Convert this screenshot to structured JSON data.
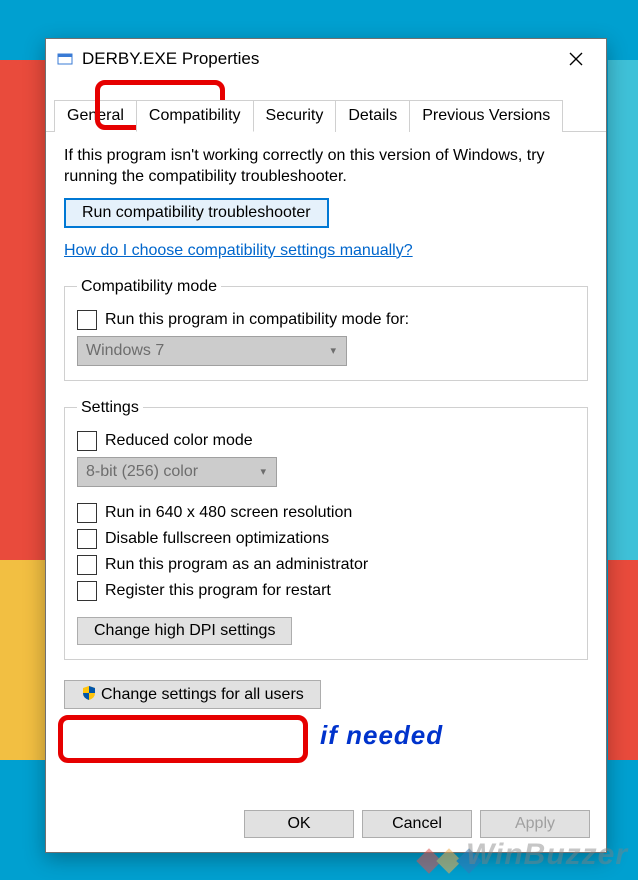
{
  "window": {
    "title": "DERBY.EXE Properties"
  },
  "tabs": {
    "general": "General",
    "compatibility": "Compatibility",
    "security": "Security",
    "details": "Details",
    "previous": "Previous Versions"
  },
  "content": {
    "intro": "If this program isn't working correctly on this version of Windows, try running the compatibility troubleshooter.",
    "run_troubleshooter": "Run compatibility troubleshooter",
    "help_link": "How do I choose compatibility settings manually?",
    "compat_mode": {
      "legend": "Compatibility mode",
      "checkbox": "Run this program in compatibility mode for:",
      "select_value": "Windows 7"
    },
    "settings": {
      "legend": "Settings",
      "reduced_color": "Reduced color mode",
      "color_select": "8-bit (256) color",
      "run_640": "Run in 640 x 480 screen resolution",
      "disable_fullscreen": "Disable fullscreen optimizations",
      "run_admin": "Run this program as an administrator",
      "register_restart": "Register this program for restart",
      "change_dpi": "Change high DPI settings"
    },
    "change_all_users": "Change settings for all users"
  },
  "buttons": {
    "ok": "OK",
    "cancel": "Cancel",
    "apply": "Apply"
  },
  "annotation": {
    "text": "if needed"
  },
  "watermark": "WinBuzzer"
}
